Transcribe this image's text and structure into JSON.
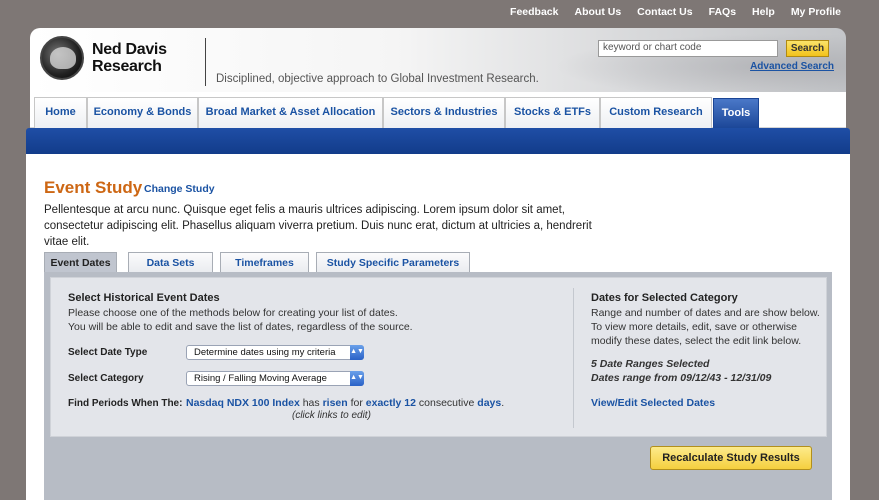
{
  "topnav": {
    "feedback": "Feedback",
    "about": "About Us",
    "contact": "Contact Us",
    "faqs": "FAQs",
    "help": "Help",
    "profile": "My Profile"
  },
  "brand": {
    "line1": "Ned Davis",
    "line2": "Research",
    "tagline": "Disciplined, objective approach to Global Investment Research."
  },
  "search": {
    "placeholder": "keyword or chart code",
    "button": "Search",
    "advanced": "Advanced Search"
  },
  "mainnav": [
    "Home",
    "Economy & Bonds",
    "Broad Market & Asset Allocation",
    "Sectors & Industries",
    "Stocks & ETFs",
    "Custom Research",
    "Tools"
  ],
  "page": {
    "title": "Event Study",
    "change_link": "Change Study",
    "intro": "Pellentesque at arcu nunc. Quisque eget felis a mauris ultrices adipiscing. Lorem ipsum dolor sit amet, consectetur adipiscing elit. Phasellus aliquam viverra pretium. Duis nunc erat, dictum at ultricies a, hendrerit vitae elit."
  },
  "subtabs": [
    "Event Dates",
    "Data Sets",
    "Timeframes",
    "Study Specific Parameters"
  ],
  "left": {
    "heading": "Select Historical Event Dates",
    "desc1": "Please choose one of the methods below for creating your list of dates.",
    "desc2": "You will be able to edit and save the list of dates, regardless of the source.",
    "date_type_label": "Select Date Type",
    "date_type_value": "Determine dates using my criteria",
    "category_label": "Select Category",
    "category_value": "Rising / Falling Moving Average",
    "find_label": "Find Periods When The:",
    "index": "Nasdaq NDX 100 Index",
    "has": " has ",
    "direction": "risen",
    "for": " for ",
    "amount": "exactly 12",
    "consecutive": " consecutive ",
    "unit": "days",
    "period": ".",
    "edit_hint": "(click links to edit)"
  },
  "right": {
    "heading": "Dates for Selected Category",
    "desc1": "Range and number of dates and are show below.",
    "desc2": "To view more details, edit, save or otherwise",
    "desc3": "modify these dates, select the edit link below.",
    "selected": "5 Date Ranges Selected",
    "range": "Dates range from 09/12/43 - 12/31/09",
    "view_link": "View/Edit Selected Dates"
  },
  "recalc_button": "Recalculate Study Results"
}
